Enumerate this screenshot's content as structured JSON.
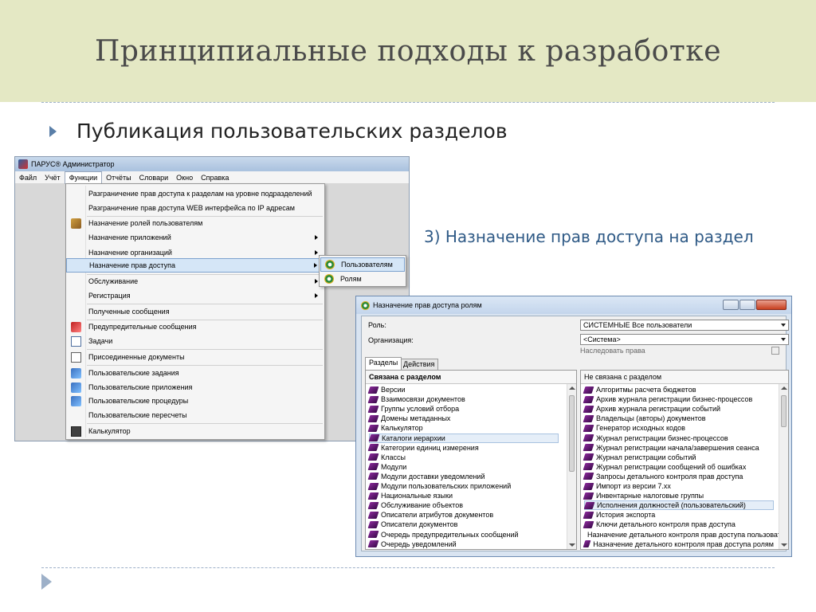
{
  "slide": {
    "title": "Принципиальные подходы к разработке",
    "bullet": "Публикация пользовательских разделов",
    "note": "3) Назначение прав доступа на раздел"
  },
  "admin_window": {
    "title": "ПАРУС® Администратор",
    "menu": [
      "Файл",
      "Учёт",
      "Функции",
      "Отчёты",
      "Словари",
      "Окно",
      "Справка"
    ],
    "active_menu": "Функции",
    "dropdown": [
      {
        "label": "Разграничение прав доступа к разделам на уровне подразделений",
        "icon": "",
        "submenu": false
      },
      {
        "label": "Разграничение прав доступа WEB интерфейса по IP адресам",
        "icon": "",
        "submenu": false
      },
      {
        "label": "Назначение ролей пользователям",
        "icon": "users-roles-icon",
        "submenu": false
      },
      {
        "label": "Назначение приложений",
        "icon": "",
        "submenu": true
      },
      {
        "label": "Назначение организаций",
        "icon": "",
        "submenu": true
      },
      {
        "label": "Назначение прав доступа",
        "icon": "",
        "submenu": true,
        "highlighted": true
      },
      {
        "label": "Обслуживание",
        "icon": "",
        "submenu": true
      },
      {
        "label": "Регистрация",
        "icon": "",
        "submenu": true
      },
      {
        "label": "Полученные сообщения",
        "icon": "",
        "submenu": false
      },
      {
        "label": "Предупредительные сообщения",
        "icon": "warning-messages-icon",
        "submenu": false
      },
      {
        "label": "Задачи",
        "icon": "tasks-icon",
        "submenu": false
      },
      {
        "label": "Присоединенные документы",
        "icon": "attached-docs-icon",
        "submenu": false
      },
      {
        "label": "Пользовательские задания",
        "icon": "user-jobs-icon",
        "submenu": false
      },
      {
        "label": "Пользовательские приложения",
        "icon": "user-apps-icon",
        "submenu": false
      },
      {
        "label": "Пользовательские процедуры",
        "icon": "user-procedures-icon",
        "submenu": false
      },
      {
        "label": "Пользовательские пересчеты",
        "icon": "",
        "submenu": false
      },
      {
        "label": "Калькулятор",
        "icon": "calculator-icon",
        "submenu": false
      }
    ],
    "submenu": [
      {
        "label": "Пользователям",
        "highlighted": true
      },
      {
        "label": "Ролям",
        "highlighted": false
      }
    ]
  },
  "rights_dialog": {
    "title": "Назначение прав доступа ролям",
    "role_label": "Роль:",
    "role_value": "СИСТЕМНЫЕ Все пользователи",
    "org_label": "Организация:",
    "org_value": "<Система>",
    "inherit_label": "Наследовать права",
    "tabs": [
      "Разделы",
      "Действия"
    ],
    "left_header": "Связана с разделом",
    "right_header": "Не связана с разделом",
    "left_items": [
      "Версии",
      "Взаимосвязи документов",
      "Группы условий отбора",
      "Домены метаданных",
      "Калькулятор",
      "Каталоги иерархии",
      "Категории единиц измерения",
      "Классы",
      "Модули",
      "Модули доставки уведомлений",
      "Модули пользовательских приложений",
      "Национальные языки",
      "Обслуживание объектов",
      "Описатели атрибутов документов",
      "Описатели документов",
      "Очередь предупредительных сообщений",
      "Очередь уведомлений"
    ],
    "left_selected": 5,
    "right_items": [
      "Алгоритмы расчета бюджетов",
      "Архив журнала регистрации бизнес-процессов",
      "Архив журнала регистрации событий",
      "Владельцы (авторы) документов",
      "Генератор исходных кодов",
      "Журнал регистрации бизнес-процессов",
      "Журнал регистрации начала/завершения сеанса",
      "Журнал регистрации событий",
      "Журнал регистрации сообщений об ошибках",
      "Запросы детального контроля прав доступа",
      "Импорт из версии 7.хх",
      "Инвентарные налоговые группы",
      "Исполнения должностей (пользовательский)",
      "История экспорта",
      "Ключи детального контроля прав доступа",
      "Назначение детального контроля прав доступа пользоват...",
      "Назначение детального контроля прав доступа ролям"
    ],
    "right_selected": 12
  }
}
